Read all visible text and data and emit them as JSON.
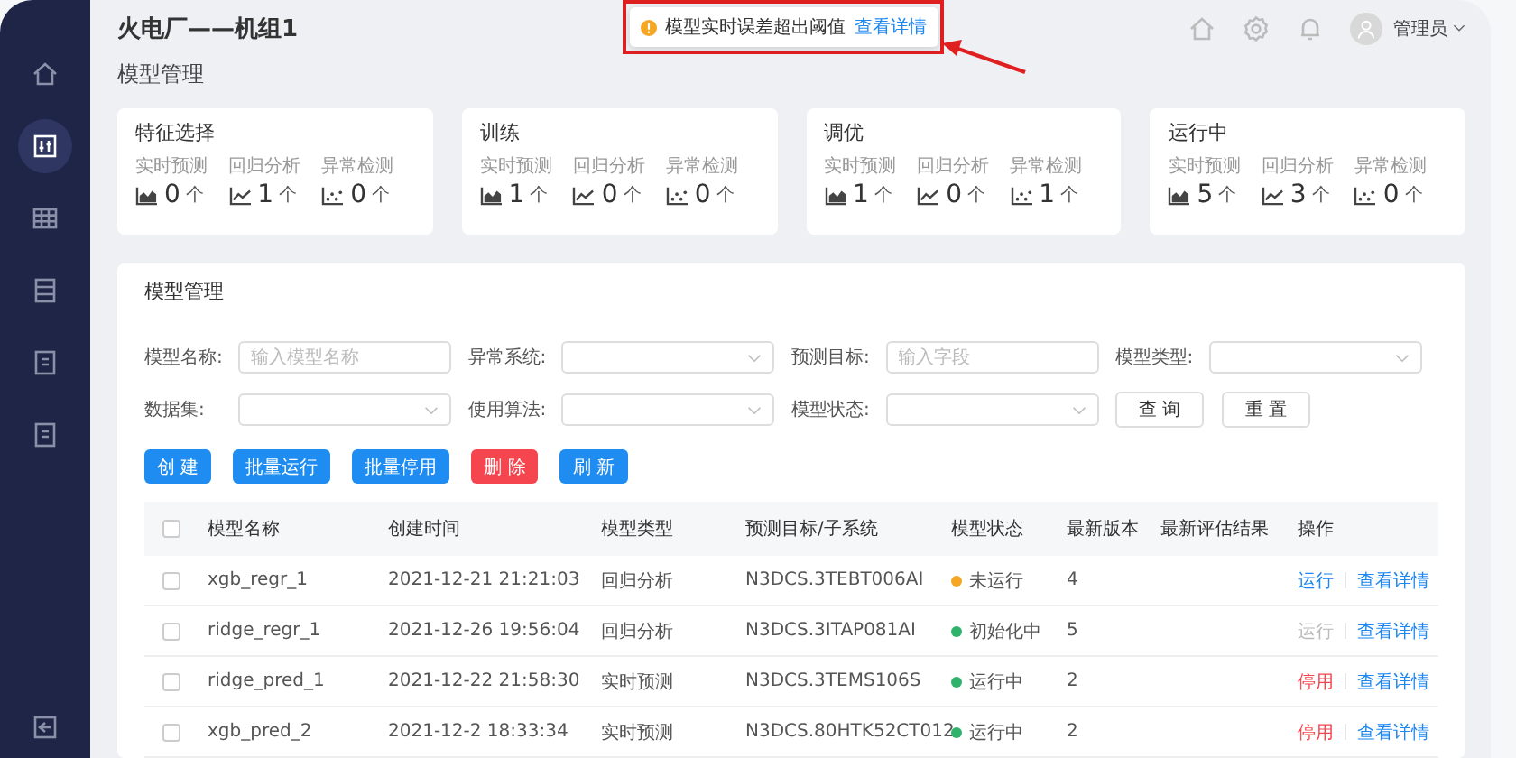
{
  "sidebar": {
    "items": [
      {
        "selected": false
      },
      {
        "selected": true
      },
      {
        "selected": false
      },
      {
        "selected": false
      },
      {
        "selected": false
      },
      {
        "selected": false
      }
    ],
    "bottom_item": {
      "selected": false
    }
  },
  "header": {
    "title": "火电厂——机组1",
    "toast": {
      "message": "模型实时误差超出阈值",
      "link": "查看详情"
    },
    "user": "管理员"
  },
  "page_title": "模型管理",
  "cards": [
    {
      "title": "特征选择",
      "metrics": [
        {
          "label": "实时预测",
          "kind": "area",
          "value": "0",
          "unit": "个"
        },
        {
          "label": "回归分析",
          "kind": "line",
          "value": "1",
          "unit": "个"
        },
        {
          "label": "异常检测",
          "kind": "scatter",
          "value": "0",
          "unit": "个"
        }
      ]
    },
    {
      "title": "训练",
      "metrics": [
        {
          "label": "实时预测",
          "kind": "area",
          "value": "1",
          "unit": "个"
        },
        {
          "label": "回归分析",
          "kind": "line",
          "value": "0",
          "unit": "个"
        },
        {
          "label": "异常检测",
          "kind": "scatter",
          "value": "0",
          "unit": "个"
        }
      ]
    },
    {
      "title": "调优",
      "metrics": [
        {
          "label": "实时预测",
          "kind": "area",
          "value": "1",
          "unit": "个"
        },
        {
          "label": "回归分析",
          "kind": "line",
          "value": "0",
          "unit": "个"
        },
        {
          "label": "异常检测",
          "kind": "scatter",
          "value": "1",
          "unit": "个"
        }
      ]
    },
    {
      "title": "运行中",
      "metrics": [
        {
          "label": "实时预测",
          "kind": "area",
          "value": "5",
          "unit": "个"
        },
        {
          "label": "回归分析",
          "kind": "line",
          "value": "3",
          "unit": "个"
        },
        {
          "label": "异常检测",
          "kind": "scatter",
          "value": "0",
          "unit": "个"
        }
      ]
    }
  ],
  "panel": {
    "title": "模型管理",
    "filters": [
      {
        "label": "模型名称:",
        "kind": "input",
        "placeholder": "输入模型名称"
      },
      {
        "label": "异常系统:",
        "kind": "select"
      },
      {
        "label": "预测目标:",
        "kind": "input",
        "placeholder": "输入字段"
      },
      {
        "label": "模型类型:",
        "kind": "select"
      },
      {
        "label": "数据集:",
        "kind": "select"
      },
      {
        "label": "使用算法:",
        "kind": "select"
      },
      {
        "label": "模型状态:",
        "kind": "select"
      }
    ],
    "filter_buttons": [
      "查 询",
      "重 置"
    ],
    "actions": [
      {
        "label": "创 建",
        "kind": "primary"
      },
      {
        "label": "批量运行",
        "kind": "primary"
      },
      {
        "label": "批量停用",
        "kind": "primary"
      },
      {
        "label": "删 除",
        "kind": "danger"
      },
      {
        "label": "刷 新",
        "kind": "primary"
      }
    ],
    "table": {
      "header_checked": false,
      "columns": [
        "模型名称",
        "创建时间",
        "模型类型",
        "预测目标/子系统",
        "模型状态",
        "最新版本",
        "最新评估结果",
        "操作"
      ],
      "rows": [
        {
          "checked": false,
          "name": "xgb_regr_1",
          "created": "2021-12-21 21:21:03",
          "type": "回归分析",
          "target": "N3DCS.3TEBT006AI",
          "status": "未运行",
          "color": "#f5a623",
          "version": "4",
          "action": {
            "label": "运行",
            "kind": "run",
            "disabled": false
          },
          "detail": "查看详情"
        },
        {
          "checked": false,
          "name": "ridge_regr_1",
          "created": "2021-12-26 19:56:04",
          "type": "回归分析",
          "target": "N3DCS.3ITAP081AI",
          "status": "初始化中",
          "color": "#2fb36b",
          "version": "5",
          "action": {
            "label": "运行",
            "kind": "run",
            "disabled": true
          },
          "detail": "查看详情"
        },
        {
          "checked": false,
          "name": "ridge_pred_1",
          "created": "2021-12-22 21:58:30",
          "type": "实时预测",
          "target": "N3DCS.3TEMS106S",
          "status": "运行中",
          "color": "#2fb36b",
          "version": "2",
          "action": {
            "label": "停用",
            "kind": "stop",
            "disabled": false
          },
          "detail": "查看详情"
        },
        {
          "checked": false,
          "name": "xgb_pred_2",
          "created": "2021-12-2 18:33:34",
          "type": "实时预测",
          "target": "N3DCS.80HTK52CT012",
          "status": "运行中",
          "color": "#2fb36b",
          "version": "2",
          "action": {
            "label": "停用",
            "kind": "stop",
            "disabled": false
          },
          "detail": "查看详情"
        }
      ]
    }
  }
}
